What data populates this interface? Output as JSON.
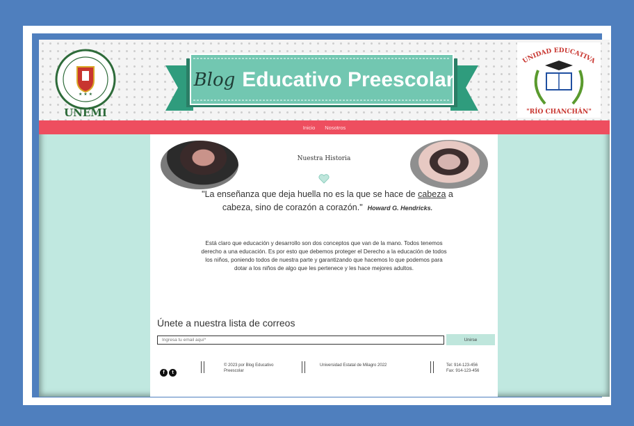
{
  "header": {
    "banner_blog": "Blog",
    "banner_title": "Educativo Preescolar",
    "logo_left_text": "UNIVERSIDAD ESTATAL DE MILAGRO",
    "logo_left_abbrev": "UNEMI",
    "logo_right_top": "UNIDAD EDUCATIVA",
    "logo_right_bottom": "\"RÍO CHANCHÁN\""
  },
  "nav": {
    "items": [
      {
        "label": "Inicio"
      },
      {
        "label": "Nosotros"
      }
    ]
  },
  "story": {
    "title": "Nuestra Historia",
    "quote_part1": "\"La enseñanza que deja huella no es la que se hace de ",
    "quote_underlined": "cabeza",
    "quote_part2": " a cabeza, sino de corazón a corazón.\"",
    "quote_author": "Howard G. Hendricks.",
    "body": "Está claro que educación y desarrollo son dos conceptos que van de la mano. Todos tenemos derecho a una educación. Es por esto que debemos proteger el Derecho a la educación de todos los niños, poniendo todos de nuestra parte y garantizando que hacemos lo que podemos para dotar a los niños de algo que les pertenece y les hace mejores adultos."
  },
  "mailing": {
    "title": "Únete a nuestra lista de correos",
    "email_placeholder": "Ingresa tu email aquí*",
    "join_label": "Unirse"
  },
  "footer": {
    "copyright_line1": "© 2023 por Blog Educativo",
    "copyright_line2": "Preescolar",
    "university": "Universidad Estatal de Milagro 2022",
    "tel": "Tel: 914-123-456",
    "fax": "Fax: 914-123-456"
  },
  "colors": {
    "frame_blue": "#4f7fbe",
    "nav_red": "#ee4e5f",
    "mint_bg": "#c0e8e0",
    "banner_green": "#6cc3ad"
  }
}
